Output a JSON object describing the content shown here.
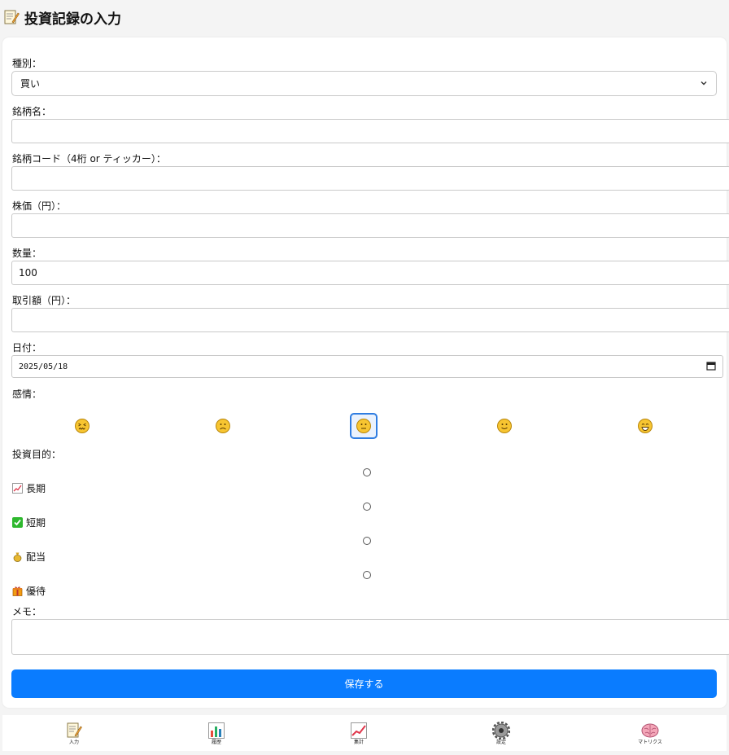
{
  "page": {
    "title": "投資記録の入力",
    "title_icon": "memo-icon"
  },
  "form": {
    "type_label": "種別：",
    "type_value": "買い",
    "name_label": "銘柄名：",
    "name_value": "",
    "code_label": "銘柄コード（4桁 or ティッカー）：",
    "code_value": "",
    "price_label": "株価（円）：",
    "price_value": "",
    "quantity_label": "数量：",
    "quantity_value": "100",
    "amount_label": "取引額（円）：",
    "amount_value": "",
    "date_label": "日付：",
    "date_value": "2025/05/18",
    "emotion_label": "感情：",
    "emotions": [
      {
        "name": "confounded-face-icon",
        "selected": false
      },
      {
        "name": "frowning-face-icon",
        "selected": false
      },
      {
        "name": "neutral-face-icon",
        "selected": true
      },
      {
        "name": "slightly-smiling-face-icon",
        "selected": false
      },
      {
        "name": "grinning-face-icon",
        "selected": false
      }
    ],
    "purpose_label": "投資目的：",
    "purposes": [
      {
        "label": "長期",
        "icon": "chart-increasing-icon"
      },
      {
        "label": "短期",
        "icon": "check-mark-icon"
      },
      {
        "label": "配当",
        "icon": "money-bag-icon"
      },
      {
        "label": "優待",
        "icon": "gift-icon"
      }
    ],
    "memo_label": "メモ：",
    "memo_value": "",
    "save_label": "保存する"
  },
  "nav": {
    "items": [
      {
        "label": "入力",
        "icon": "memo-icon"
      },
      {
        "label": "履歴",
        "icon": "bar-chart-icon"
      },
      {
        "label": "集計",
        "icon": "chart-increasing-icon"
      },
      {
        "label": "設定",
        "icon": "gear-icon"
      },
      {
        "label": "マトリクス",
        "icon": "brain-icon"
      }
    ]
  },
  "colors": {
    "accent": "#0a7cff",
    "selected_border": "#2f7de1",
    "background": "#f4f4f4",
    "card": "#ffffff"
  }
}
